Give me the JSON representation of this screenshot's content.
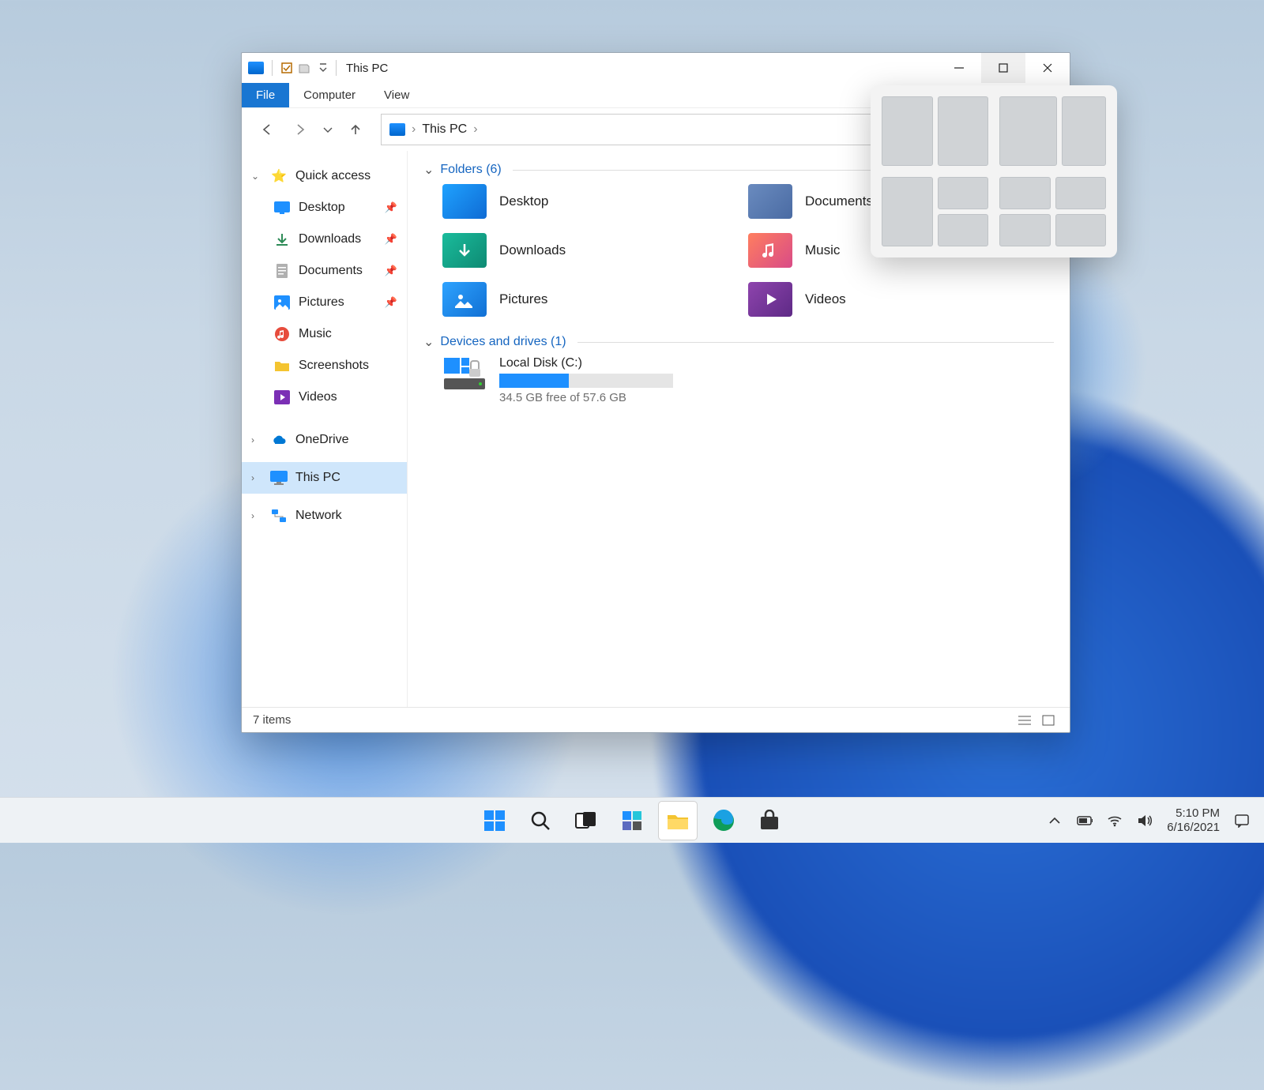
{
  "window": {
    "title": "This PC",
    "menubar": {
      "file": "File",
      "computer": "Computer",
      "view": "View"
    },
    "address": {
      "location": "This PC"
    }
  },
  "sidebar": {
    "quick_access": "Quick access",
    "items": [
      {
        "label": "Desktop",
        "pinned": true
      },
      {
        "label": "Downloads",
        "pinned": true
      },
      {
        "label": "Documents",
        "pinned": true
      },
      {
        "label": "Pictures",
        "pinned": true
      },
      {
        "label": "Music",
        "pinned": false
      },
      {
        "label": "Screenshots",
        "pinned": false
      },
      {
        "label": "Videos",
        "pinned": false
      }
    ],
    "onedrive": "OneDrive",
    "this_pc": "This PC",
    "network": "Network"
  },
  "content": {
    "folders_header": "Folders (6)",
    "folders": [
      {
        "label": "Desktop"
      },
      {
        "label": "Documents"
      },
      {
        "label": "Downloads"
      },
      {
        "label": "Music"
      },
      {
        "label": "Pictures"
      },
      {
        "label": "Videos"
      }
    ],
    "drives_header": "Devices and drives (1)",
    "drive": {
      "label": "Local Disk (C:)",
      "free_text": "34.5 GB free of 57.6 GB",
      "used_pct": 40
    }
  },
  "statusbar": {
    "items": "7 items"
  },
  "taskbar": {
    "time": "5:10 PM",
    "date": "6/16/2021"
  }
}
